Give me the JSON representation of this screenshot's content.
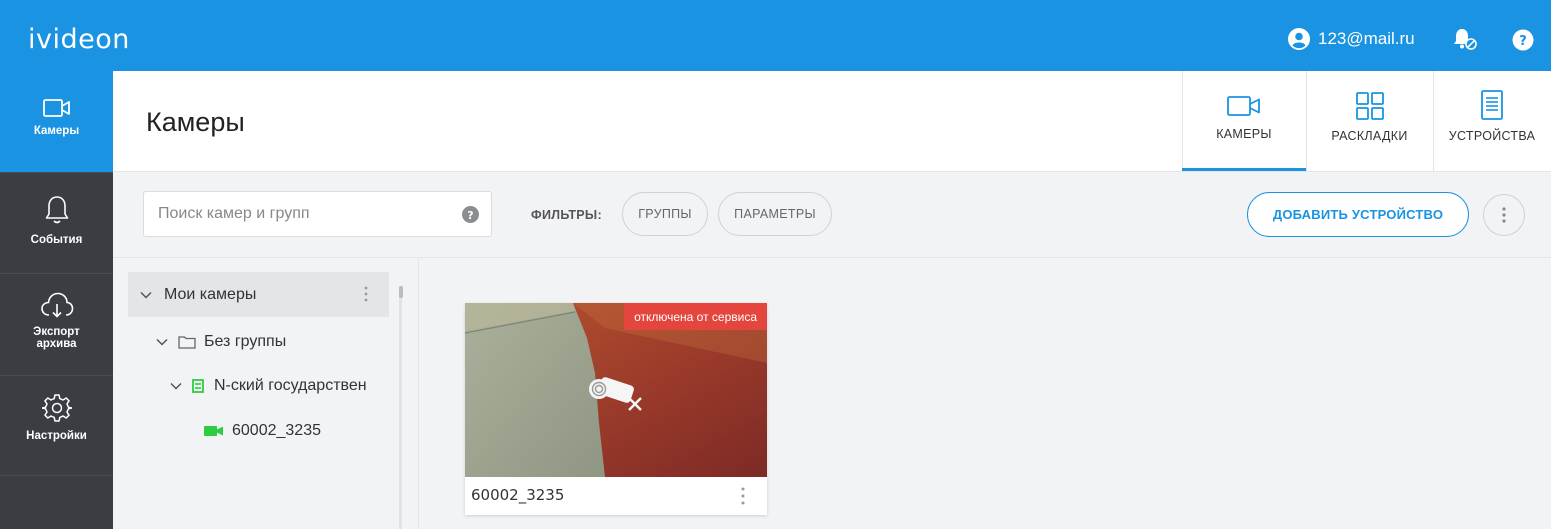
{
  "app": {
    "logo": "ivideon"
  },
  "topbar": {
    "user_email": "123@mail.ru"
  },
  "sidebar": {
    "items": [
      {
        "label": "Камеры",
        "active": true
      },
      {
        "label": "События"
      },
      {
        "label": "Экспорт архива"
      },
      {
        "label": "Настройки"
      }
    ]
  },
  "header": {
    "title": "Камеры",
    "view_tabs": [
      {
        "label": "КАМЕРЫ",
        "active": true
      },
      {
        "label": "РАСКЛАДКИ"
      },
      {
        "label": "УСТРОЙСТВА"
      }
    ]
  },
  "toolbar": {
    "search_placeholder": "Поиск камер и групп",
    "filters_label": "ФИЛЬТРЫ:",
    "filter_groups": "ГРУППЫ",
    "filter_params": "ПАРАМЕТРЫ",
    "add_device": "ДОБАВИТЬ УСТРОЙСТВО"
  },
  "tree": {
    "root": "Мои камеры",
    "group": "Без группы",
    "server": "N-ский государствен",
    "camera": "60002_3235"
  },
  "camera_card": {
    "name": "60002_3235",
    "status_badge": "отключена от сервиса"
  },
  "colors": {
    "accent": "#1a93e2",
    "sidebar": "#3a3d42",
    "offline_badge": "#e4453d",
    "online_green": "#2ecc40"
  }
}
